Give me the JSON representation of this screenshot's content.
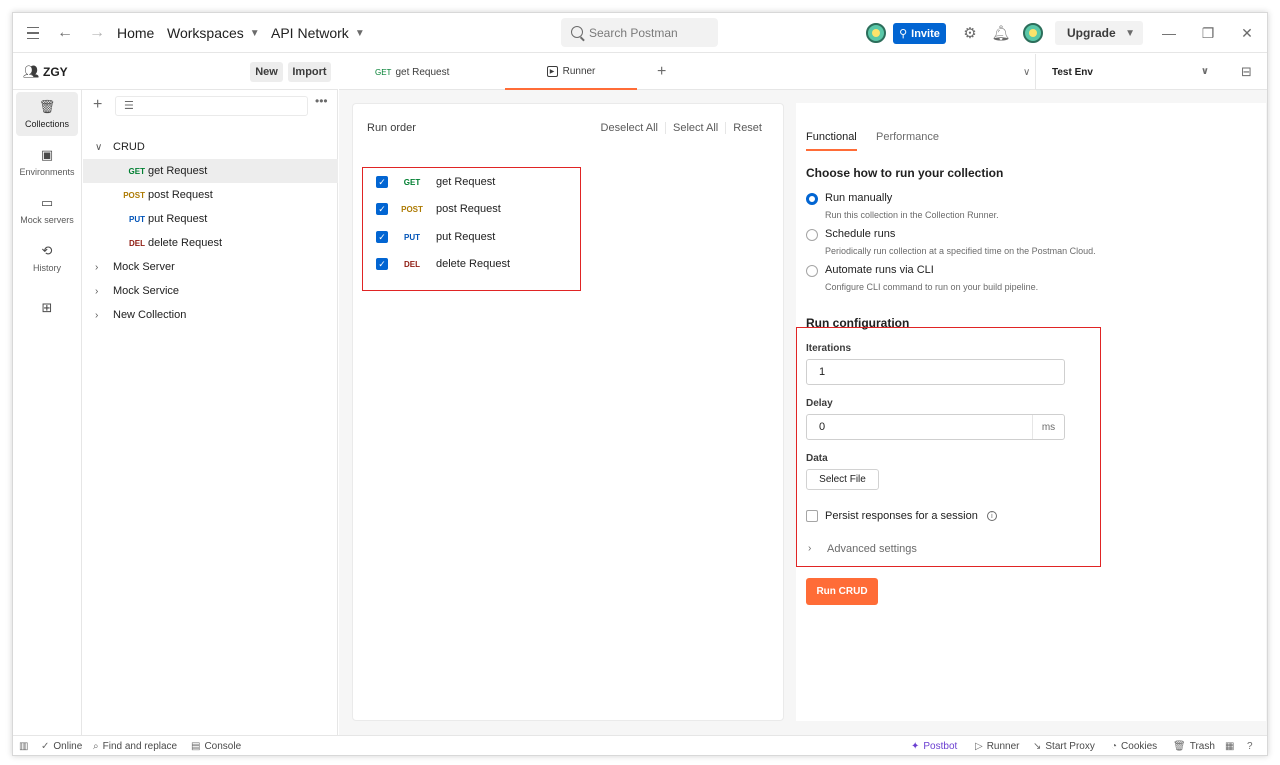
{
  "topbar": {
    "home": "Home",
    "workspaces": "Workspaces",
    "api_network": "API Network",
    "search_placeholder": "Search Postman",
    "invite": "Invite",
    "upgrade": "Upgrade"
  },
  "workspace": {
    "name": "ZGY",
    "new_label": "New",
    "import_label": "Import"
  },
  "rail": [
    {
      "label": "Collections",
      "icon": "trash-can-icon"
    },
    {
      "label": "Environments",
      "icon": "environment-icon"
    },
    {
      "label": "Mock servers",
      "icon": "server-icon"
    },
    {
      "label": "History",
      "icon": "history-icon"
    }
  ],
  "tree": {
    "collection": "CRUD",
    "requests": [
      {
        "method": "GET",
        "name": "get Request"
      },
      {
        "method": "POST",
        "name": "post Request"
      },
      {
        "method": "PUT",
        "name": "put Request"
      },
      {
        "method": "DEL",
        "name": "delete Request"
      }
    ],
    "others": [
      "Mock Server",
      "Mock Service",
      "New Collection"
    ]
  },
  "tabs": {
    "tab1_method": "GET",
    "tab1_name": "get Request",
    "tab2_name": "Runner",
    "env": "Test Env"
  },
  "run_order": {
    "title": "Run order",
    "deselect_all": "Deselect All",
    "select_all": "Select All",
    "reset": "Reset",
    "items": [
      {
        "method": "GET",
        "name": "get Request",
        "checked": true
      },
      {
        "method": "POST",
        "name": "post Request",
        "checked": true
      },
      {
        "method": "PUT",
        "name": "put Request",
        "checked": true
      },
      {
        "method": "DEL",
        "name": "delete Request",
        "checked": true
      }
    ]
  },
  "config": {
    "tab_functional": "Functional",
    "tab_performance": "Performance",
    "choose_title": "Choose how to run your collection",
    "options": [
      {
        "label": "Run manually",
        "desc": "Run this collection in the Collection Runner.",
        "selected": true
      },
      {
        "label": "Schedule runs",
        "desc": "Periodically run collection at a specified time on the Postman Cloud.",
        "selected": false
      },
      {
        "label": "Automate runs via CLI",
        "desc": "Configure CLI command to run on your build pipeline.",
        "selected": false
      }
    ],
    "run_config_title": "Run configuration",
    "iterations_label": "Iterations",
    "iterations_value": "1",
    "delay_label": "Delay",
    "delay_value": "0",
    "delay_unit": "ms",
    "data_label": "Data",
    "select_file": "Select File",
    "persist_label": "Persist responses for a session",
    "advanced": "Advanced settings",
    "run_button": "Run CRUD"
  },
  "footer": {
    "online": "Online",
    "find_replace": "Find and replace",
    "console": "Console",
    "postbot": "Postbot",
    "runner": "Runner",
    "start_proxy": "Start Proxy",
    "cookies": "Cookies",
    "trash": "Trash"
  },
  "colors": {
    "accent": "#ff6c37",
    "primary": "#0265d2",
    "highlight": "#e02424"
  }
}
